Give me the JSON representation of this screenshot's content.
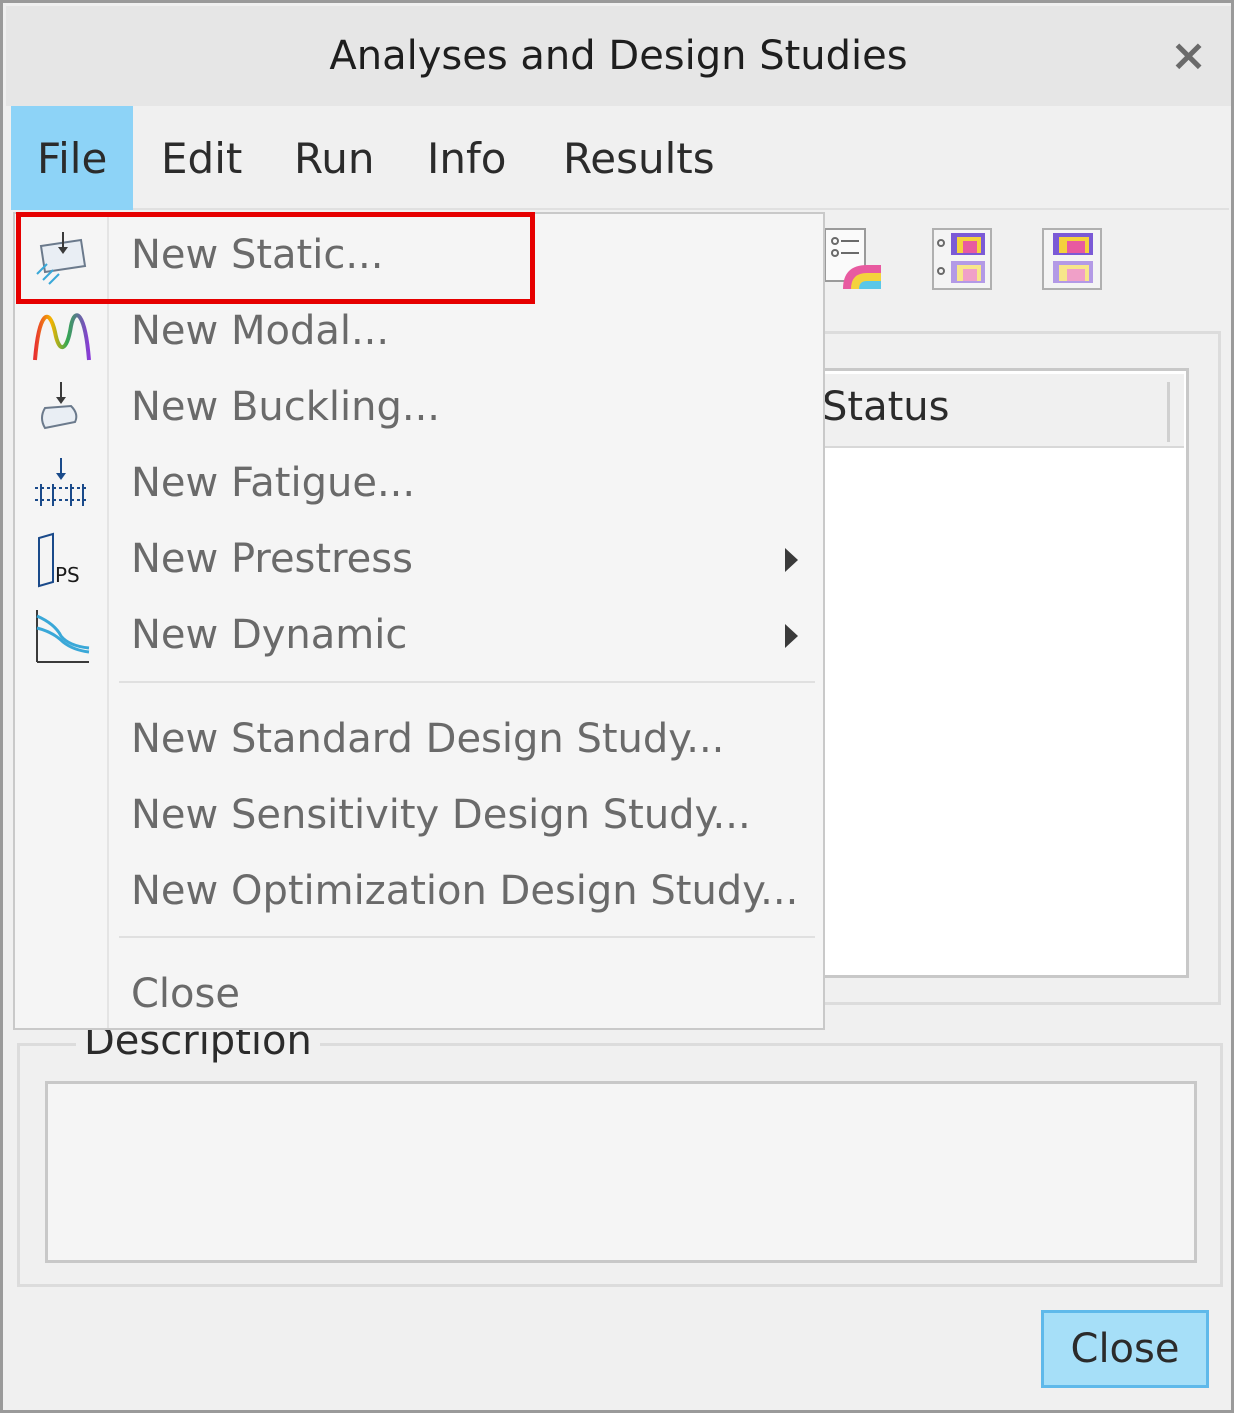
{
  "window": {
    "title": "Analyses and Design Studies",
    "close_glyph": "×"
  },
  "menubar": {
    "items": [
      {
        "label": "File",
        "active": true
      },
      {
        "label": "Edit"
      },
      {
        "label": "Run"
      },
      {
        "label": "Info"
      },
      {
        "label": "Results"
      }
    ]
  },
  "list": {
    "visible_column": "Status"
  },
  "dropdown": {
    "items": [
      {
        "label": "New Static...",
        "icon": "static-analysis-icon"
      },
      {
        "label": "New Modal...",
        "icon": "modal-analysis-icon"
      },
      {
        "label": "New Buckling...",
        "icon": "buckling-analysis-icon"
      },
      {
        "label": "New Fatigue...",
        "icon": "fatigue-analysis-icon"
      },
      {
        "label": "New Prestress",
        "icon": "prestress-analysis-icon",
        "submenu": true
      },
      {
        "label": "New Dynamic",
        "icon": "dynamic-analysis-icon",
        "submenu": true
      },
      {
        "label": "New Standard Design Study..."
      },
      {
        "label": "New Sensitivity Design Study..."
      },
      {
        "label": "New Optimization Design Study..."
      },
      {
        "label": "Close"
      }
    ],
    "highlighted": "New Static..."
  },
  "description": {
    "label": "Description",
    "value": ""
  },
  "footer": {
    "close_label": "Close"
  },
  "colors": {
    "menu_active": "#8dd3f7",
    "highlight": "#e60000",
    "button_bg": "#a6dff8"
  }
}
